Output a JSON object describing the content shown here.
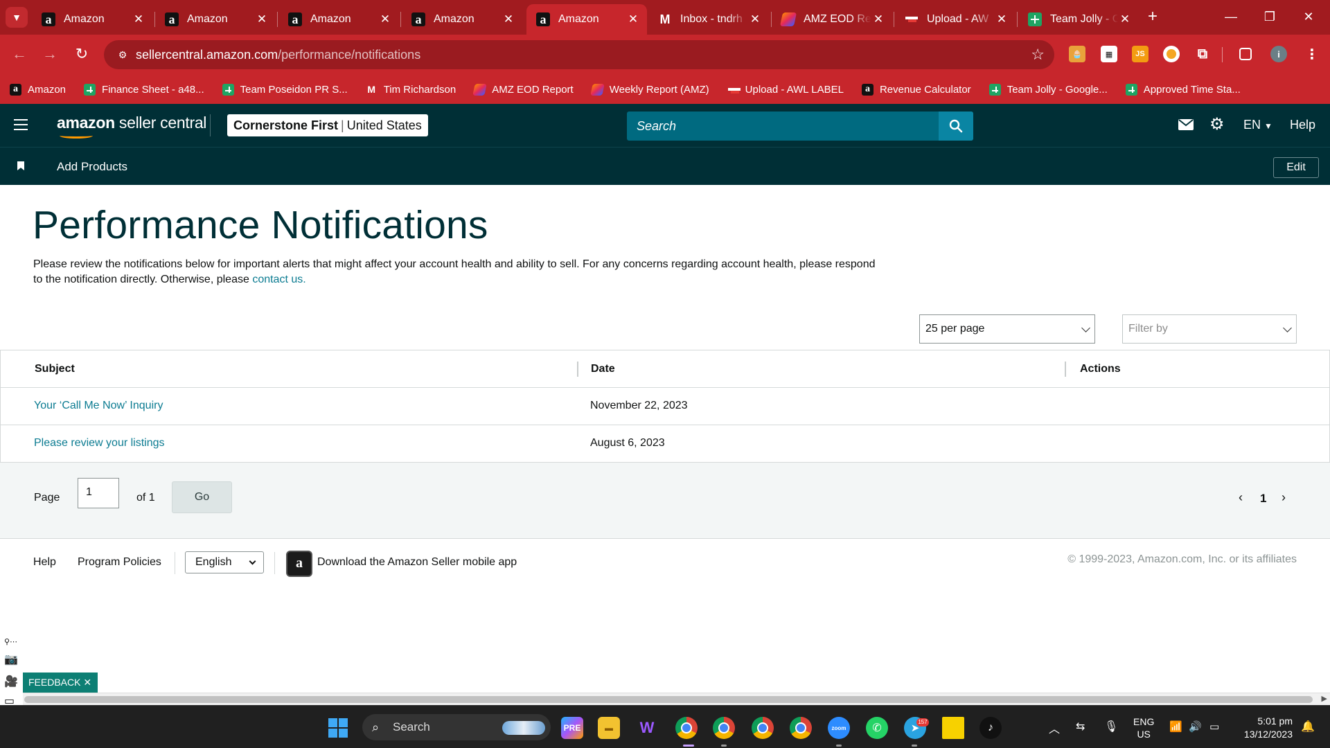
{
  "browser": {
    "tabs": [
      {
        "title": "Amazon",
        "favicon": "amazon-icon",
        "active": false
      },
      {
        "title": "Amazon",
        "favicon": "amazon-icon",
        "active": false
      },
      {
        "title": "Amazon",
        "favicon": "amazon-icon",
        "active": false
      },
      {
        "title": "Amazon",
        "favicon": "amazon-icon",
        "active": false
      },
      {
        "title": "Amazon",
        "favicon": "amazon-icon",
        "active": true
      },
      {
        "title": "Inbox - tndrh",
        "favicon": "gmail-icon",
        "active": false
      },
      {
        "title": "AMZ EOD Re",
        "favicon": "form-icon",
        "active": false
      },
      {
        "title": "Upload - AW",
        "favicon": "flag-icon",
        "active": false
      },
      {
        "title": "Team Jolly - G",
        "favicon": "sheets-icon",
        "active": false
      }
    ],
    "url_host": "sellercentral.amazon.com",
    "url_path": "/performance/notifications",
    "bookmarks": [
      {
        "label": "Amazon",
        "icon": "amazon-icon"
      },
      {
        "label": "Finance Sheet - a48...",
        "icon": "sheets-icon"
      },
      {
        "label": "Team Poseidon PR S...",
        "icon": "sheets-icon"
      },
      {
        "label": "Tim Richardson",
        "icon": "gmail-icon"
      },
      {
        "label": "AMZ EOD Report",
        "icon": "form-icon"
      },
      {
        "label": "Weekly Report (AMZ)",
        "icon": "form-icon"
      },
      {
        "label": "Upload - AWL LABEL",
        "icon": "flag-icon"
      },
      {
        "label": "Revenue Calculator",
        "icon": "amazon-icon"
      },
      {
        "label": "Team Jolly - Google...",
        "icon": "sheets-icon"
      },
      {
        "label": "Approved Time Sta...",
        "icon": "sheets-icon"
      }
    ],
    "colors": {
      "frame": "#a11b1f",
      "toolbar": "#c7262c"
    }
  },
  "header": {
    "logo_bold": "amazon",
    "logo_rest": " seller central",
    "store_name": "Cornerstone First",
    "marketplace": "United States",
    "search_placeholder": "Search",
    "language": "EN",
    "help": "Help"
  },
  "subnav": {
    "add_products": "Add Products",
    "edit": "Edit"
  },
  "main": {
    "title": "Performance Notifications",
    "intro_text": "Please review the notifications below for important alerts that might affect your account health and ability to sell. For any concerns regarding account health, please respond to the notification directly. Otherwise, please ",
    "intro_link": "contact us.",
    "per_page": "25 per page",
    "filter_placeholder": "Filter by",
    "columns": {
      "subject": "Subject",
      "date": "Date",
      "actions": "Actions"
    },
    "rows": [
      {
        "subject": "Your ‘Call Me Now’ Inquiry",
        "date": "November 22, 2023"
      },
      {
        "subject": "Please review your listings",
        "date": "August 6, 2023"
      }
    ],
    "pager": {
      "page_label": "Page",
      "page_value": "1",
      "of_label": "of 1",
      "go": "Go",
      "current": "1"
    }
  },
  "footer": {
    "help": "Help",
    "policies": "Program Policies",
    "language": "English",
    "app_text": "Download the Amazon Seller mobile app",
    "copyright": "© 1999-2023, Amazon.com, Inc. or its affiliates"
  },
  "overlay": {
    "feedback": "FEEDBACK ✕"
  },
  "taskbar": {
    "search": "Search",
    "lang_top": "ENG",
    "lang_bottom": "US",
    "time": "5:01 pm",
    "date": "13/12/2023",
    "telegram_badge": "157"
  },
  "accent": {
    "teal": "#002f36",
    "link": "#0b7b91",
    "search_bg": "#006a80"
  }
}
